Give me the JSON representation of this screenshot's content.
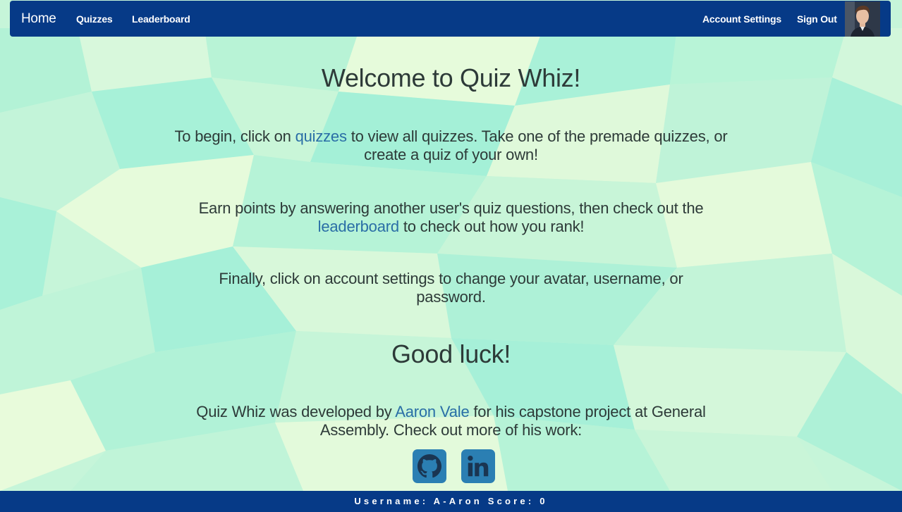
{
  "nav": {
    "brand": "Home",
    "links": [
      "Quizzes",
      "Leaderboard"
    ],
    "right_links": [
      "Account Settings",
      "Sign Out"
    ]
  },
  "main": {
    "title": "Welcome to Quiz Whiz!",
    "p1_before": "To begin, click on ",
    "p1_link": "quizzes",
    "p1_after": " to view all quizzes. Take one of the premade quizzes, or create a quiz of your own!",
    "p2_before": "Earn points by answering another user's quiz questions, then check out the ",
    "p2_link": "leaderboard",
    "p2_after": " to check out how you rank!",
    "p3": "Finally, click on account settings to change your avatar, username, or password.",
    "good_luck": "Good luck!",
    "p4_before": "Quiz Whiz was developed by ",
    "p4_link": "Aaron Vale",
    "p4_after": " for his capstone project at General Assembly. Check out more of his work:",
    "social": [
      "github-icon",
      "linkedin-icon"
    ]
  },
  "footer": {
    "username_label": "Username:",
    "username": "A-Aron",
    "score_label": "Score:",
    "score": "0"
  },
  "colors": {
    "nav_bg": "#063a87",
    "link": "#2a6ea6",
    "social_bg": "#2b7fb3",
    "bg_light": "#eafadb",
    "bg_mid": "#c8f5d8",
    "bg_teal": "#a6f1d6"
  }
}
